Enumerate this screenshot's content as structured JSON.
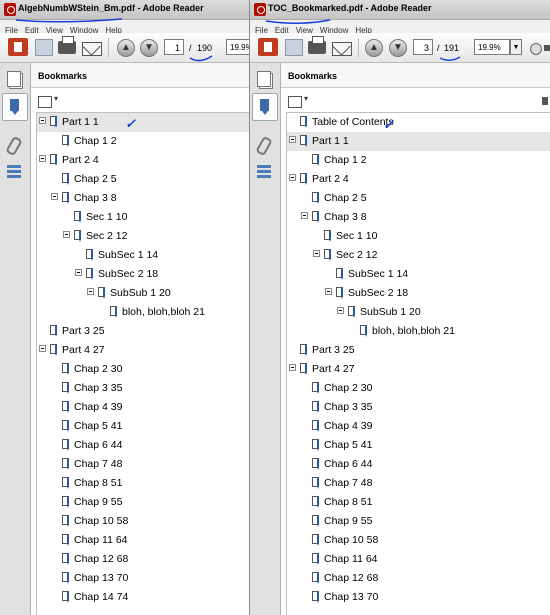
{
  "left_window": {
    "title_file": "AlgebNumbWStein_Bm.pdf",
    "title_sep": " - ",
    "title_app": "Adobe Reader",
    "menu": [
      "File",
      "Edit",
      "View",
      "Window",
      "Help"
    ],
    "page_current": "1",
    "page_sep": "/",
    "page_total": "190",
    "zoom": "19.9%",
    "panel_title": "Bookmarks",
    "bookmarks": [
      {
        "label": "Part 1 1",
        "level": 0,
        "expanded": true,
        "selected": true
      },
      {
        "label": "Chap 1 2",
        "level": 1
      },
      {
        "label": "Part 2 4",
        "level": 0,
        "expanded": true
      },
      {
        "label": "Chap 2 5",
        "level": 1
      },
      {
        "label": "Chap 3 8",
        "level": 1,
        "expanded": true
      },
      {
        "label": "Sec 1 10",
        "level": 2
      },
      {
        "label": "Sec 2 12",
        "level": 2,
        "expanded": true
      },
      {
        "label": "SubSec 1 14",
        "level": 3
      },
      {
        "label": "SubSec 2 18",
        "level": 3,
        "expanded": true
      },
      {
        "label": "SubSub 1 20",
        "level": 4,
        "expanded": true
      },
      {
        "label": "bloh, bloh,bloh 21",
        "level": 5
      },
      {
        "label": "Part 3 25",
        "level": 0
      },
      {
        "label": "Part 4 27",
        "level": 0,
        "expanded": true
      },
      {
        "label": "Chap 2 30",
        "level": 1
      },
      {
        "label": "Chap 3 35",
        "level": 1
      },
      {
        "label": "Chap 4 39",
        "level": 1
      },
      {
        "label": "Chap 5 41",
        "level": 1
      },
      {
        "label": "Chap 6 44",
        "level": 1
      },
      {
        "label": "Chap 7 48",
        "level": 1
      },
      {
        "label": "Chap 8 51",
        "level": 1
      },
      {
        "label": "Chap 9 55",
        "level": 1
      },
      {
        "label": "Chap 10 58",
        "level": 1
      },
      {
        "label": "Chap 11 64",
        "level": 1
      },
      {
        "label": "Chap 12 68",
        "level": 1
      },
      {
        "label": "Chap 13 70",
        "level": 1
      },
      {
        "label": "Chap 14 74",
        "level": 1
      }
    ]
  },
  "right_window": {
    "title_file": "TOC_Bookmarked.pdf",
    "title_sep": " - ",
    "title_app": "Adobe Reader",
    "menu": [
      "File",
      "Edit",
      "View",
      "Window",
      "Help"
    ],
    "page_current": "3",
    "page_sep": "/",
    "page_total": "191",
    "zoom": "19.9%",
    "panel_title": "Bookmarks",
    "bookmarks": [
      {
        "label": "Table of Contents",
        "level": 0
      },
      {
        "label": "Part 1 1",
        "level": 0,
        "expanded": true,
        "selected": true
      },
      {
        "label": "Chap 1 2",
        "level": 1
      },
      {
        "label": "Part 2 4",
        "level": 0,
        "expanded": true
      },
      {
        "label": "Chap 2 5",
        "level": 1
      },
      {
        "label": "Chap 3 8",
        "level": 1,
        "expanded": true
      },
      {
        "label": "Sec 1 10",
        "level": 2
      },
      {
        "label": "Sec 2 12",
        "level": 2,
        "expanded": true
      },
      {
        "label": "SubSec 1 14",
        "level": 3
      },
      {
        "label": "SubSec 2 18",
        "level": 3,
        "expanded": true
      },
      {
        "label": "SubSub 1 20",
        "level": 4,
        "expanded": true
      },
      {
        "label": "bloh, bloh,bloh 21",
        "level": 5
      },
      {
        "label": "Part 3 25",
        "level": 0
      },
      {
        "label": "Part 4 27",
        "level": 0,
        "expanded": true
      },
      {
        "label": "Chap 2 30",
        "level": 1
      },
      {
        "label": "Chap 3 35",
        "level": 1
      },
      {
        "label": "Chap 4 39",
        "level": 1
      },
      {
        "label": "Chap 5 41",
        "level": 1
      },
      {
        "label": "Chap 6 44",
        "level": 1
      },
      {
        "label": "Chap 7 48",
        "level": 1
      },
      {
        "label": "Chap 8 51",
        "level": 1
      },
      {
        "label": "Chap 9 55",
        "level": 1
      },
      {
        "label": "Chap 10 58",
        "level": 1
      },
      {
        "label": "Chap 11 64",
        "level": 1
      },
      {
        "label": "Chap 12 68",
        "level": 1
      },
      {
        "label": "Chap 13 70",
        "level": 1
      }
    ]
  },
  "annotations": {
    "checkmark": "✓",
    "ink_color": "#1a3fd8"
  }
}
